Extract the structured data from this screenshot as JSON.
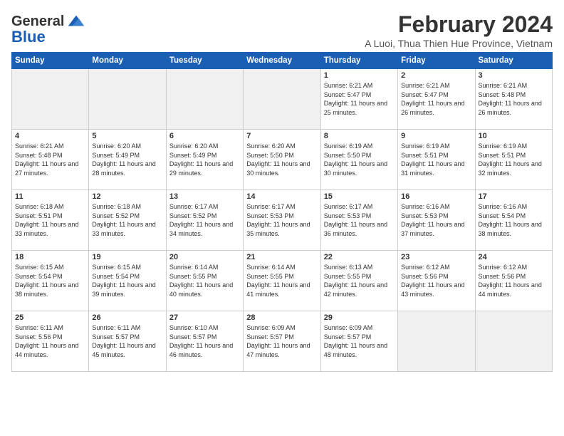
{
  "header": {
    "logo_line1": "General",
    "logo_line2": "Blue",
    "month_year": "February 2024",
    "location": "A Luoi, Thua Thien Hue Province, Vietnam"
  },
  "days_of_week": [
    "Sunday",
    "Monday",
    "Tuesday",
    "Wednesday",
    "Thursday",
    "Friday",
    "Saturday"
  ],
  "weeks": [
    [
      {
        "day": "",
        "sunrise": "",
        "sunset": "",
        "daylight": "",
        "empty": true
      },
      {
        "day": "",
        "sunrise": "",
        "sunset": "",
        "daylight": "",
        "empty": true
      },
      {
        "day": "",
        "sunrise": "",
        "sunset": "",
        "daylight": "",
        "empty": true
      },
      {
        "day": "",
        "sunrise": "",
        "sunset": "",
        "daylight": "",
        "empty": true
      },
      {
        "day": "1",
        "sunrise": "6:21 AM",
        "sunset": "5:47 PM",
        "daylight": "11 hours and 25 minutes.",
        "empty": false
      },
      {
        "day": "2",
        "sunrise": "6:21 AM",
        "sunset": "5:47 PM",
        "daylight": "11 hours and 26 minutes.",
        "empty": false
      },
      {
        "day": "3",
        "sunrise": "6:21 AM",
        "sunset": "5:48 PM",
        "daylight": "11 hours and 26 minutes.",
        "empty": false
      }
    ],
    [
      {
        "day": "4",
        "sunrise": "6:21 AM",
        "sunset": "5:48 PM",
        "daylight": "11 hours and 27 minutes.",
        "empty": false
      },
      {
        "day": "5",
        "sunrise": "6:20 AM",
        "sunset": "5:49 PM",
        "daylight": "11 hours and 28 minutes.",
        "empty": false
      },
      {
        "day": "6",
        "sunrise": "6:20 AM",
        "sunset": "5:49 PM",
        "daylight": "11 hours and 29 minutes.",
        "empty": false
      },
      {
        "day": "7",
        "sunrise": "6:20 AM",
        "sunset": "5:50 PM",
        "daylight": "11 hours and 30 minutes.",
        "empty": false
      },
      {
        "day": "8",
        "sunrise": "6:19 AM",
        "sunset": "5:50 PM",
        "daylight": "11 hours and 30 minutes.",
        "empty": false
      },
      {
        "day": "9",
        "sunrise": "6:19 AM",
        "sunset": "5:51 PM",
        "daylight": "11 hours and 31 minutes.",
        "empty": false
      },
      {
        "day": "10",
        "sunrise": "6:19 AM",
        "sunset": "5:51 PM",
        "daylight": "11 hours and 32 minutes.",
        "empty": false
      }
    ],
    [
      {
        "day": "11",
        "sunrise": "6:18 AM",
        "sunset": "5:51 PM",
        "daylight": "11 hours and 33 minutes.",
        "empty": false
      },
      {
        "day": "12",
        "sunrise": "6:18 AM",
        "sunset": "5:52 PM",
        "daylight": "11 hours and 33 minutes.",
        "empty": false
      },
      {
        "day": "13",
        "sunrise": "6:17 AM",
        "sunset": "5:52 PM",
        "daylight": "11 hours and 34 minutes.",
        "empty": false
      },
      {
        "day": "14",
        "sunrise": "6:17 AM",
        "sunset": "5:53 PM",
        "daylight": "11 hours and 35 minutes.",
        "empty": false
      },
      {
        "day": "15",
        "sunrise": "6:17 AM",
        "sunset": "5:53 PM",
        "daylight": "11 hours and 36 minutes.",
        "empty": false
      },
      {
        "day": "16",
        "sunrise": "6:16 AM",
        "sunset": "5:53 PM",
        "daylight": "11 hours and 37 minutes.",
        "empty": false
      },
      {
        "day": "17",
        "sunrise": "6:16 AM",
        "sunset": "5:54 PM",
        "daylight": "11 hours and 38 minutes.",
        "empty": false
      }
    ],
    [
      {
        "day": "18",
        "sunrise": "6:15 AM",
        "sunset": "5:54 PM",
        "daylight": "11 hours and 38 minutes.",
        "empty": false
      },
      {
        "day": "19",
        "sunrise": "6:15 AM",
        "sunset": "5:54 PM",
        "daylight": "11 hours and 39 minutes.",
        "empty": false
      },
      {
        "day": "20",
        "sunrise": "6:14 AM",
        "sunset": "5:55 PM",
        "daylight": "11 hours and 40 minutes.",
        "empty": false
      },
      {
        "day": "21",
        "sunrise": "6:14 AM",
        "sunset": "5:55 PM",
        "daylight": "11 hours and 41 minutes.",
        "empty": false
      },
      {
        "day": "22",
        "sunrise": "6:13 AM",
        "sunset": "5:55 PM",
        "daylight": "11 hours and 42 minutes.",
        "empty": false
      },
      {
        "day": "23",
        "sunrise": "6:12 AM",
        "sunset": "5:56 PM",
        "daylight": "11 hours and 43 minutes.",
        "empty": false
      },
      {
        "day": "24",
        "sunrise": "6:12 AM",
        "sunset": "5:56 PM",
        "daylight": "11 hours and 44 minutes.",
        "empty": false
      }
    ],
    [
      {
        "day": "25",
        "sunrise": "6:11 AM",
        "sunset": "5:56 PM",
        "daylight": "11 hours and 44 minutes.",
        "empty": false
      },
      {
        "day": "26",
        "sunrise": "6:11 AM",
        "sunset": "5:57 PM",
        "daylight": "11 hours and 45 minutes.",
        "empty": false
      },
      {
        "day": "27",
        "sunrise": "6:10 AM",
        "sunset": "5:57 PM",
        "daylight": "11 hours and 46 minutes.",
        "empty": false
      },
      {
        "day": "28",
        "sunrise": "6:09 AM",
        "sunset": "5:57 PM",
        "daylight": "11 hours and 47 minutes.",
        "empty": false
      },
      {
        "day": "29",
        "sunrise": "6:09 AM",
        "sunset": "5:57 PM",
        "daylight": "11 hours and 48 minutes.",
        "empty": false
      },
      {
        "day": "",
        "sunrise": "",
        "sunset": "",
        "daylight": "",
        "empty": true
      },
      {
        "day": "",
        "sunrise": "",
        "sunset": "",
        "daylight": "",
        "empty": true
      }
    ]
  ],
  "labels": {
    "sunrise_prefix": "Sunrise: ",
    "sunset_prefix": "Sunset: ",
    "daylight_prefix": "Daylight: "
  }
}
